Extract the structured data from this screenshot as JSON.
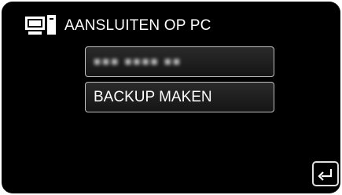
{
  "header": {
    "title": "AANSLUITEN OP PC",
    "icon": "computer-icon"
  },
  "menu": {
    "items": [
      {
        "label": "■■■ ■■■■ ■■",
        "state": "blurred"
      },
      {
        "label": "BACKUP MAKEN",
        "state": "normal"
      }
    ]
  },
  "footer": {
    "back_icon": "return-arrow-icon"
  },
  "colors": {
    "background": "#000000",
    "text": "#ffffff",
    "button_border": "#bfbfbf"
  }
}
